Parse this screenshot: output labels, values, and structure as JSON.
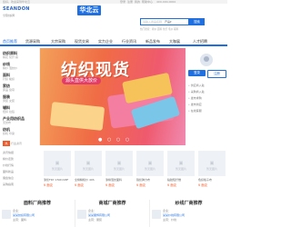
{
  "topbar": {
    "left_text": "您好，欢迎来到华北云",
    "right_links": [
      "登录",
      "注册",
      "我的",
      "帮助中心",
      "400-000-0000"
    ]
  },
  "header": {
    "logo_text": "SEANDON",
    "logo_sub": "全国纺织网",
    "brand_label": "华北云",
    "search_placeholder": "请输入商品名称",
    "search_scope": "产品",
    "search_button": "搜索",
    "hot_words": "热门搜索：棉纱 面料 化纤 毛纱 辅料"
  },
  "nav": {
    "items": [
      "首页推荐",
      "货源采购",
      "大宗采购",
      "现货交易",
      "实力企业",
      "行业资讯",
      "新品发布",
      "大咖展",
      "人才招聘"
    ],
    "active_index": 0,
    "accent_color": "#1f6fe0"
  },
  "sidebar": {
    "categories": [
      {
        "heading": "纺织原料",
        "sub": "棉花 化纤 麻"
      },
      {
        "heading": "纱线",
        "sub": "棉纱 混纺纱"
      },
      {
        "heading": "面料",
        "sub": "针织 梭织"
      },
      {
        "heading": "家纺",
        "sub": "床品 窗帘"
      },
      {
        "heading": "服装",
        "sub": "男装 女装"
      },
      {
        "heading": "辅料",
        "sub": "纽扣 拉链"
      },
      {
        "heading": "产业用纺织品",
        "sub": "无纺布"
      },
      {
        "heading": "纺机",
        "sub": "织机 印染"
      }
    ],
    "footer_tag": "热",
    "footer_text": "行业资讯"
  },
  "banner": {
    "headline": "纺织现货",
    "pill_text": "源头直供大放价",
    "dots": "● ○ ○ ○"
  },
  "right_panel": {
    "login_label": "登录",
    "register_label": "注册",
    "lines": [
      "• 供应商入驻",
      "• 采购商入驻",
      "• 发布求购",
      "• 发布供应",
      "• 在线客服"
    ]
  },
  "left_mini": {
    "rows": [
      "资讯快报",
      "棉价走势",
      "纱线行情",
      "面料新品",
      "展会信息",
      "采购指南"
    ]
  },
  "products": [
    {
      "img_caption": "暂无图片",
      "name": "涤纶FDY 150D/48F",
      "price": "¥ 面议"
    },
    {
      "img_caption": "暂无图片",
      "name": "全棉精梳纱 40S",
      "price": "¥ 面议"
    },
    {
      "img_caption": "暂无图片",
      "name": "涤棉混纺面料",
      "price": "¥ 面议"
    },
    {
      "img_caption": "暂无图片",
      "name": "锦纶弹力布",
      "price": "¥ 面议"
    },
    {
      "img_caption": "暂无图片",
      "name": "粘胶短纤维",
      "price": "¥ 面议"
    },
    {
      "img_caption": "暂无图片",
      "name": "色织格子布",
      "price": "¥ 面议"
    }
  ],
  "recommend": [
    {
      "title": "面料厂商推荐",
      "lines": [
        "企业：",
        "某某纺织有限公司",
        "主营：面料"
      ]
    },
    {
      "title": "商城厂商推荐",
      "lines": [
        "企业：",
        "某某服饰有限公司",
        "主营：服装"
      ]
    },
    {
      "title": "纱线厂商推荐",
      "lines": [
        "企业：",
        "某某纱线有限公司",
        "主营：纱线"
      ]
    }
  ]
}
